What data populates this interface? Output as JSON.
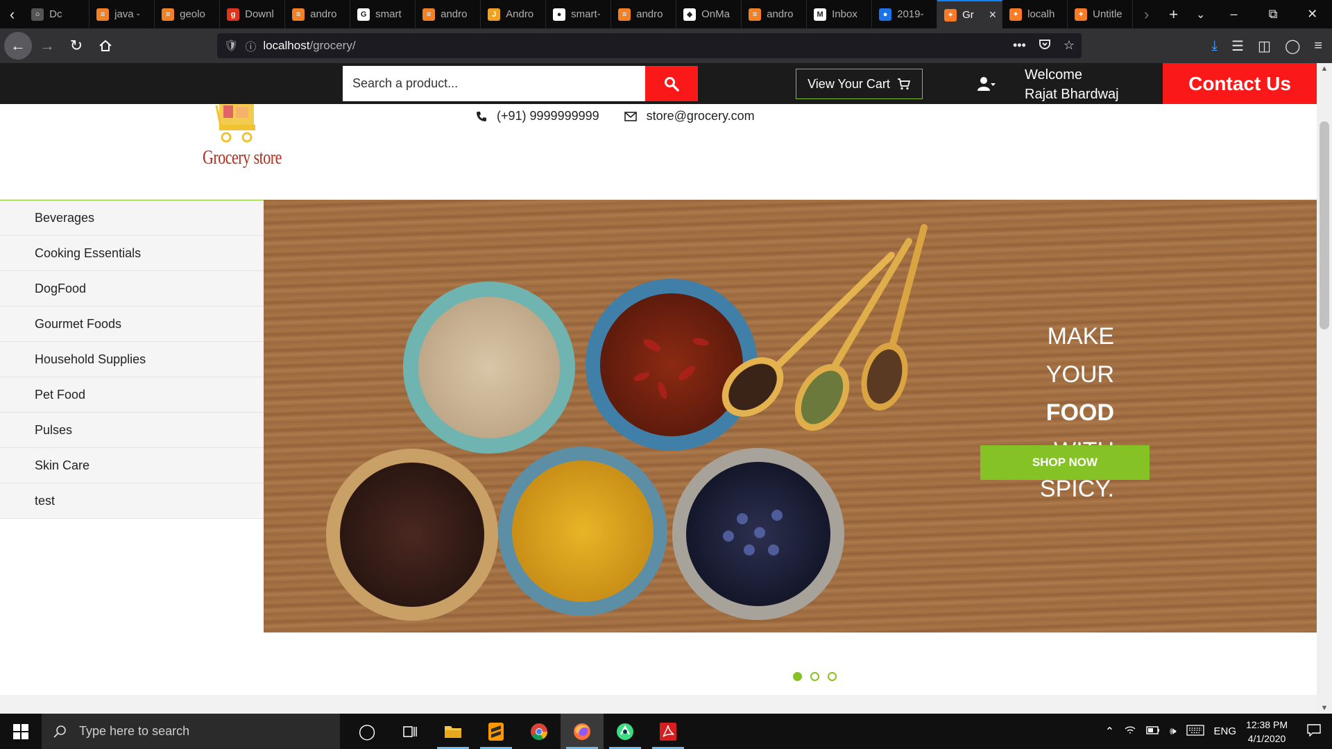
{
  "browser": {
    "tabs": [
      {
        "title": "Dc",
        "favicon": "generic-icon",
        "color": "#555555"
      },
      {
        "title": "java -",
        "favicon": "stackoverflow-icon",
        "color": "#f48024"
      },
      {
        "title": "geolo",
        "favicon": "stackoverflow-icon",
        "color": "#f48024"
      },
      {
        "title": "Downl",
        "favicon": "g-letter-icon",
        "color": "#e0351b"
      },
      {
        "title": "andro",
        "favicon": "stackoverflow-icon",
        "color": "#f48024"
      },
      {
        "title": "smart",
        "favicon": "google-icon",
        "color": "#ffffff"
      },
      {
        "title": "andro",
        "favicon": "stackoverflow-icon",
        "color": "#f48024"
      },
      {
        "title": "Andro",
        "favicon": "j-letter-icon",
        "color": "#f0a21f"
      },
      {
        "title": "smart-",
        "favicon": "github-icon",
        "color": "#ffffff"
      },
      {
        "title": "andro",
        "favicon": "stackoverflow-icon",
        "color": "#f48024"
      },
      {
        "title": "OnMa",
        "favicon": "onmap-icon",
        "color": "#ffffff"
      },
      {
        "title": "andro",
        "favicon": "stackoverflow-icon",
        "color": "#f48024"
      },
      {
        "title": "Inbox",
        "favicon": "gmail-icon",
        "color": "#ffffff"
      },
      {
        "title": "2019-",
        "favicon": "contacts-icon",
        "color": "#1a73e8"
      },
      {
        "title": "Gr",
        "favicon": "xampp-icon",
        "color": "#fb7a24",
        "active": true
      },
      {
        "title": "localh",
        "favicon": "xampp-icon",
        "color": "#fb7a24"
      },
      {
        "title": "Untitle",
        "favicon": "xampp-icon",
        "color": "#fb7a24"
      }
    ],
    "url_host": "localhost",
    "url_path": "/grocery/"
  },
  "site": {
    "search_placeholder": "Search a product...",
    "cart_label": "View Your Cart",
    "welcome_line1": "Welcome",
    "welcome_line2": "Rajat Bhardwaj",
    "contact_label": "Contact Us",
    "logo_text": "Grocery store",
    "phone": "(+91) 9999999999",
    "email": "store@grocery.com",
    "accent_color": "#84c225",
    "red_color": "#fa1818"
  },
  "categories": [
    "Beverages",
    "Cooking Essentials",
    "DogFood",
    "Gourmet Foods",
    "Household Supplies",
    "Pet Food",
    "Pulses",
    "Skin Care",
    "test"
  ],
  "hero": {
    "line1": "MAKE YOUR",
    "line2": "FOOD",
    "line3": "WITH SPICY.",
    "cta": "SHOP NOW",
    "slides": 3,
    "active_slide": 1
  },
  "taskbar": {
    "search_placeholder": "Type here to search",
    "language": "ENG",
    "time": "12:38 PM",
    "date": "4/1/2020"
  }
}
